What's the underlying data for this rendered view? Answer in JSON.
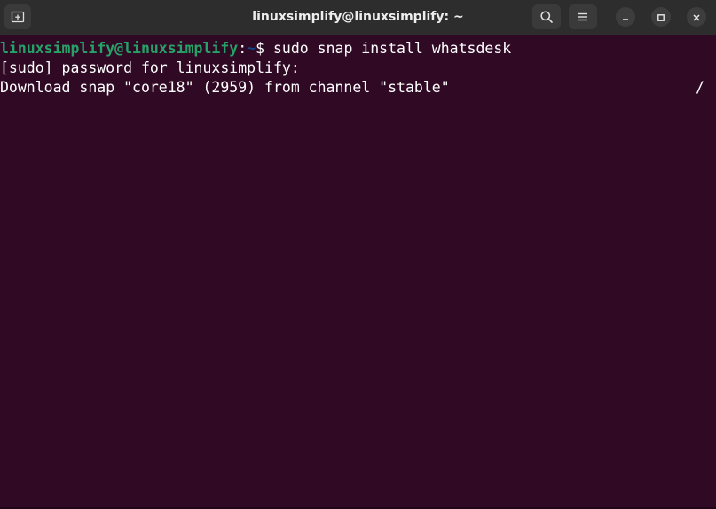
{
  "window": {
    "title": "linuxsimplify@linuxsimplify: ~",
    "colors": {
      "titlebar": "#2d2d2d",
      "terminal_bg": "#300a24",
      "prompt_user": "#26a269",
      "prompt_path": "#12488b",
      "text": "#ffffff"
    }
  },
  "titlebar": {
    "new_tab_icon": "new-tab-icon",
    "search_icon": "search-icon",
    "menu_icon": "hamburger-menu-icon",
    "minimize_icon": "minimize-icon",
    "maximize_icon": "maximize-icon",
    "close_icon": "close-icon"
  },
  "terminal": {
    "prompt": {
      "user_host": "linuxsimplify@linuxsimplify",
      "separator": ":",
      "path": "~",
      "symbol": "$ ",
      "command": "sudo snap install whatsdesk"
    },
    "output": [
      "[sudo] password for linuxsimplify:",
      "Download snap \"core18\" (2959) from channel \"stable\""
    ],
    "spinner": "/"
  }
}
